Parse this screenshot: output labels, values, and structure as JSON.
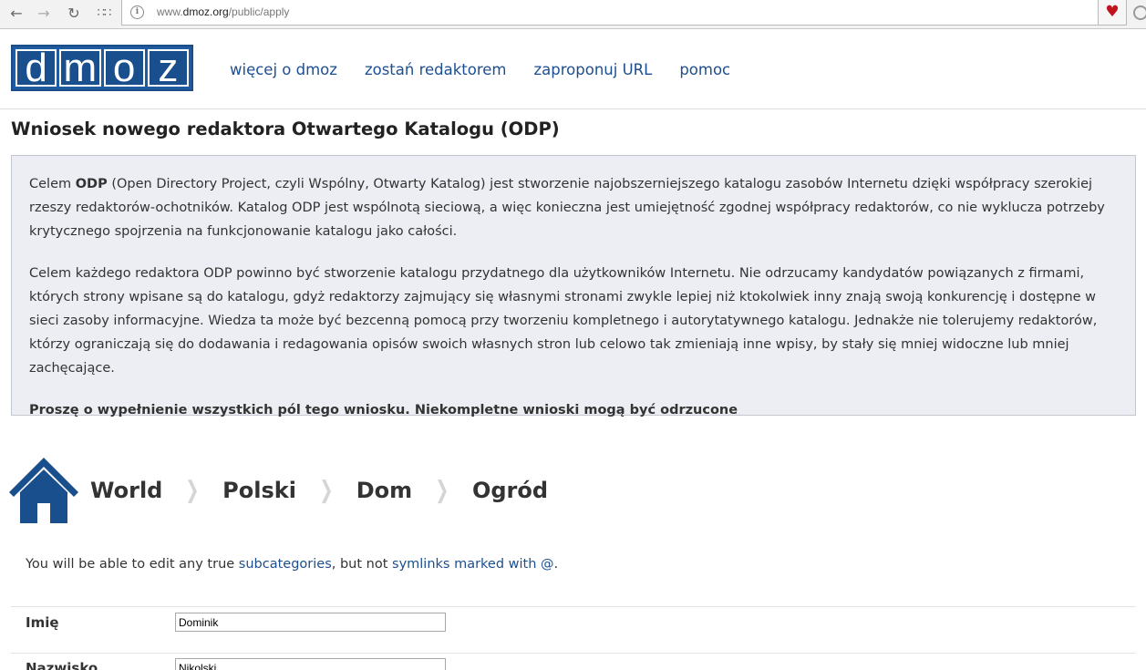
{
  "browser": {
    "url_prefix": "www.",
    "url_host": "dmoz.org",
    "url_path": "/public/apply",
    "back_icon": "arrow-left-icon",
    "forward_icon": "arrow-right-icon",
    "reload_icon": "reload-icon",
    "apps_icon": "apps-grid-icon",
    "info_icon": "site-info-icon",
    "heart_icon": "heart-icon",
    "heart_color": "#c0141c"
  },
  "header": {
    "logo_letters": [
      "d",
      "m",
      "o",
      "z"
    ],
    "logo_color": "#205b9f",
    "nav": [
      {
        "label": "więcej o dmoz"
      },
      {
        "label": "zostań redaktorem"
      },
      {
        "label": "zaproponuj URL"
      },
      {
        "label": "pomoc"
      }
    ],
    "link_color": "#1c4f91"
  },
  "page_title": "Wniosek nowego redaktora Otwartego Katalogu (ODP)",
  "intro": {
    "p1_before": "Celem ",
    "p1_bold": "ODP",
    "p1_after": " (Open Directory Project, czyli Wspólny, Otwarty Katalog) jest stworzenie najobszerniejszego katalogu zasobów Internetu dzięki współpracy szerokiej rzeszy redaktorów-ochotników. Katalog ODP jest wspólnotą sieciową, a więc konieczna jest umiejętność zgodnej współpracy redaktorów, co nie wyklucza potrzeby krytycznego spojrzenia na funkcjonowanie katalogu jako całości.",
    "p2": "Celem każdego redaktora ODP powinno być stworzenie katalogu przydatnego dla użytkowników Internetu. Nie odrzucamy kandydatów powiązanych z firmami, których strony wpisane są do katalogu, gdyż redaktorzy zajmujący się własnymi stronami zwykle lepiej niż ktokolwiek inny znają swoją konkurencję i dostępne w sieci zasoby informacyjne. Wiedza ta może być bezcenną pomocą przy tworzeniu kompletnego i autorytatywnego katalogu. Jednakże nie tolerujemy redaktorów, którzy ograniczają się do dodawania i redagowania opisów swoich własnych stron lub celowo tak zmieniają inne wpisy, by stały się mniej widoczne lub mniej zachęcające.",
    "p3": "Proszę o wypełnienie wszystkich pól tego wniosku. Niekompletne wnioski mogą być odrzucone"
  },
  "breadcrumb": {
    "home_icon": "home-icon",
    "items": [
      "World",
      "Polski",
      "Dom",
      "Ogród"
    ],
    "separator": "❯"
  },
  "note": {
    "before": "You will be able to edit any true ",
    "link1": "subcategories",
    "middle": ", but not ",
    "link2": "symlinks marked with @",
    "after": "."
  },
  "form": {
    "fields": [
      {
        "label": "Imię",
        "value": "Dominik"
      },
      {
        "label": "Nazwisko",
        "value": "Nikolski"
      }
    ]
  }
}
